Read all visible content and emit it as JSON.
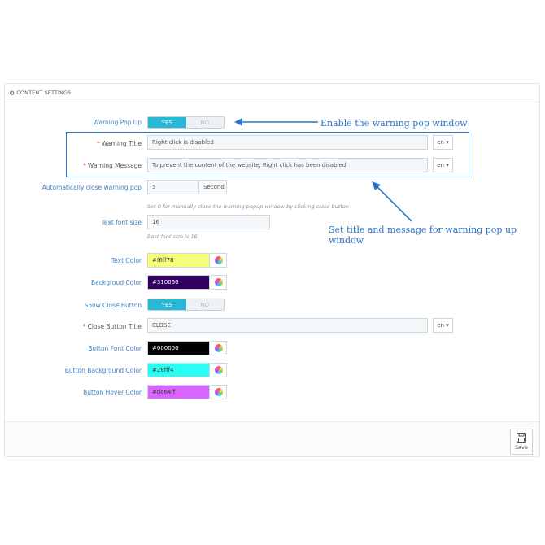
{
  "panel": {
    "title": "CONTENT SETTINGS",
    "title_icon": "gears-icon"
  },
  "toggle_labels": {
    "yes": "YES",
    "no": "NO"
  },
  "warning_popup": {
    "label": "Warning Pop Up",
    "value": "YES"
  },
  "warning_title": {
    "label": "Warning Title",
    "value": "Right click is disabled",
    "lang": "en"
  },
  "warning_message": {
    "label": "Warning Message",
    "value": "To prevent the content of the website, Right click has been disabled",
    "lang": "en"
  },
  "auto_close": {
    "label": "Automatically close warning pop",
    "value": "5",
    "unit": "Second",
    "hint": "Set 0 for manually close the warning popup window by clicking close button"
  },
  "text_font_size": {
    "label": "Text font size",
    "value": "16",
    "hint": "Best font size is 16"
  },
  "text_color": {
    "label": "Text Color",
    "value": "#f6ff78",
    "swatch": "#f6ff78",
    "text": "#333333"
  },
  "background_color": {
    "label": "Backgroud Color",
    "value": "#310060",
    "swatch": "#310060",
    "text": "#ffffff"
  },
  "show_close_button": {
    "label": "Show Close Button",
    "value": "YES"
  },
  "close_button_title": {
    "label": "Close Button Title",
    "value": "CLOSE",
    "lang": "en"
  },
  "button_font_color": {
    "label": "Button Font Color",
    "value": "#000000",
    "swatch": "#000000",
    "text": "#ffffff"
  },
  "button_background_color": {
    "label": "Button Background Color",
    "value": "#28fff4",
    "swatch": "#28fff4",
    "text": "#333333"
  },
  "button_hover_color": {
    "label": "Button Hover Color",
    "value": "#da64ff",
    "swatch": "#da64ff",
    "text": "#333333"
  },
  "footer": {
    "save_label": "Save"
  },
  "annotations": {
    "enable": "Enable the warning pop window",
    "title_message": "Set title and message for warning pop up window"
  },
  "colors": {
    "accent": "#25b9d7",
    "label": "#3b82c4",
    "annotation": "#2a73c7",
    "required": "#e2402e"
  }
}
